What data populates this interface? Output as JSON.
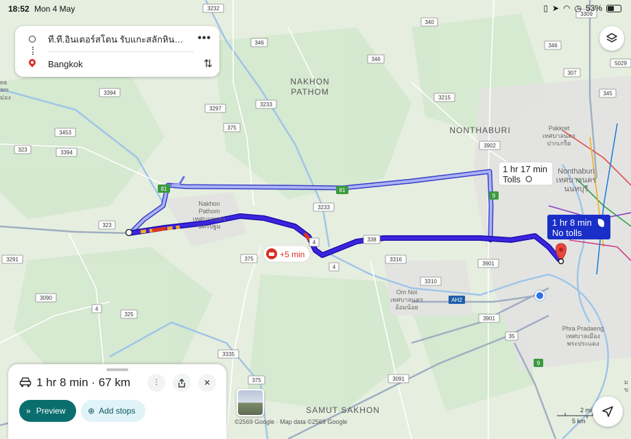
{
  "status_bar": {
    "time": "18:52",
    "date": "Mon 4 May",
    "battery": "53%"
  },
  "directions": {
    "origin": "ที.ที.อินเตอร์สโตน รับแกะสลักหินอ่อน หิน...",
    "destination": "Bangkok",
    "more_icon": "more-vert-icon",
    "swap_icon": "swap-vertical-icon"
  },
  "map": {
    "places": [
      {
        "name": "NAKHON\nPATHOM",
        "kind": "region"
      },
      {
        "name": "NONTHABURI",
        "kind": "region"
      },
      {
        "name": "SAMUT SAKHON",
        "kind": "region"
      },
      {
        "name": "Nakhon\nPathom\nเทศบาลนคร\nนครปฐม",
        "kind": "city"
      },
      {
        "name": "Pakkret\nเทศบาลนคร\nปากเกร็ด",
        "kind": "city"
      },
      {
        "name": "Nonthaburi\nเทศบาลนคร\nนนทบุรี",
        "kind": "city"
      },
      {
        "name": "Om Noi\nเทศบาลนคร\nอ้อมน้อย",
        "kind": "city"
      },
      {
        "name": "Phra Pradaeng\nเทศบาลเมือง\nพระประแดง",
        "kind": "city"
      },
      {
        "name": "ea\nam\nม่อง",
        "kind": "edge"
      },
      {
        "name": "ม\nข",
        "kind": "edge"
      }
    ],
    "road_shields": [
      "3232",
      "340",
      "3309",
      "346",
      "346",
      "346",
      "307",
      "5029",
      "3394",
      "3297",
      "3233",
      "3215",
      "345",
      "3453",
      "3394",
      "323",
      "375",
      "3902",
      "323",
      "3233",
      "4",
      "4",
      "338",
      "3316",
      "375",
      "3901",
      "3291",
      "3310",
      "3090",
      "4",
      "325",
      "3901",
      "35",
      "3335",
      "375",
      "3091",
      "AH2",
      "81",
      "81",
      "9",
      "9"
    ],
    "routes": [
      {
        "label_time": "1 hr 17 min",
        "label_detail": "Tolls",
        "selected": false
      },
      {
        "label_time": "1 hr 8 min",
        "label_detail": "No tolls",
        "selected": true
      }
    ],
    "traffic_delay": "+5 min",
    "colors": {
      "route_selected": "#2f1fd6",
      "route_alt": "#9aa3f5",
      "label_selected_bg": "#1a2fc8",
      "destination_pin": "#e8453c",
      "traffic_orange": "#f5a623",
      "traffic_red": "#e0341f"
    }
  },
  "bottom_sheet": {
    "summary": "1 hr 8 min · 67 km",
    "preview_label": "Preview",
    "add_stops_label": "Add stops"
  },
  "footer": {
    "copyright": "©2569 Google · Map data ©2569 Google",
    "scale_miles": "2 mi",
    "scale_km": "5 km"
  }
}
